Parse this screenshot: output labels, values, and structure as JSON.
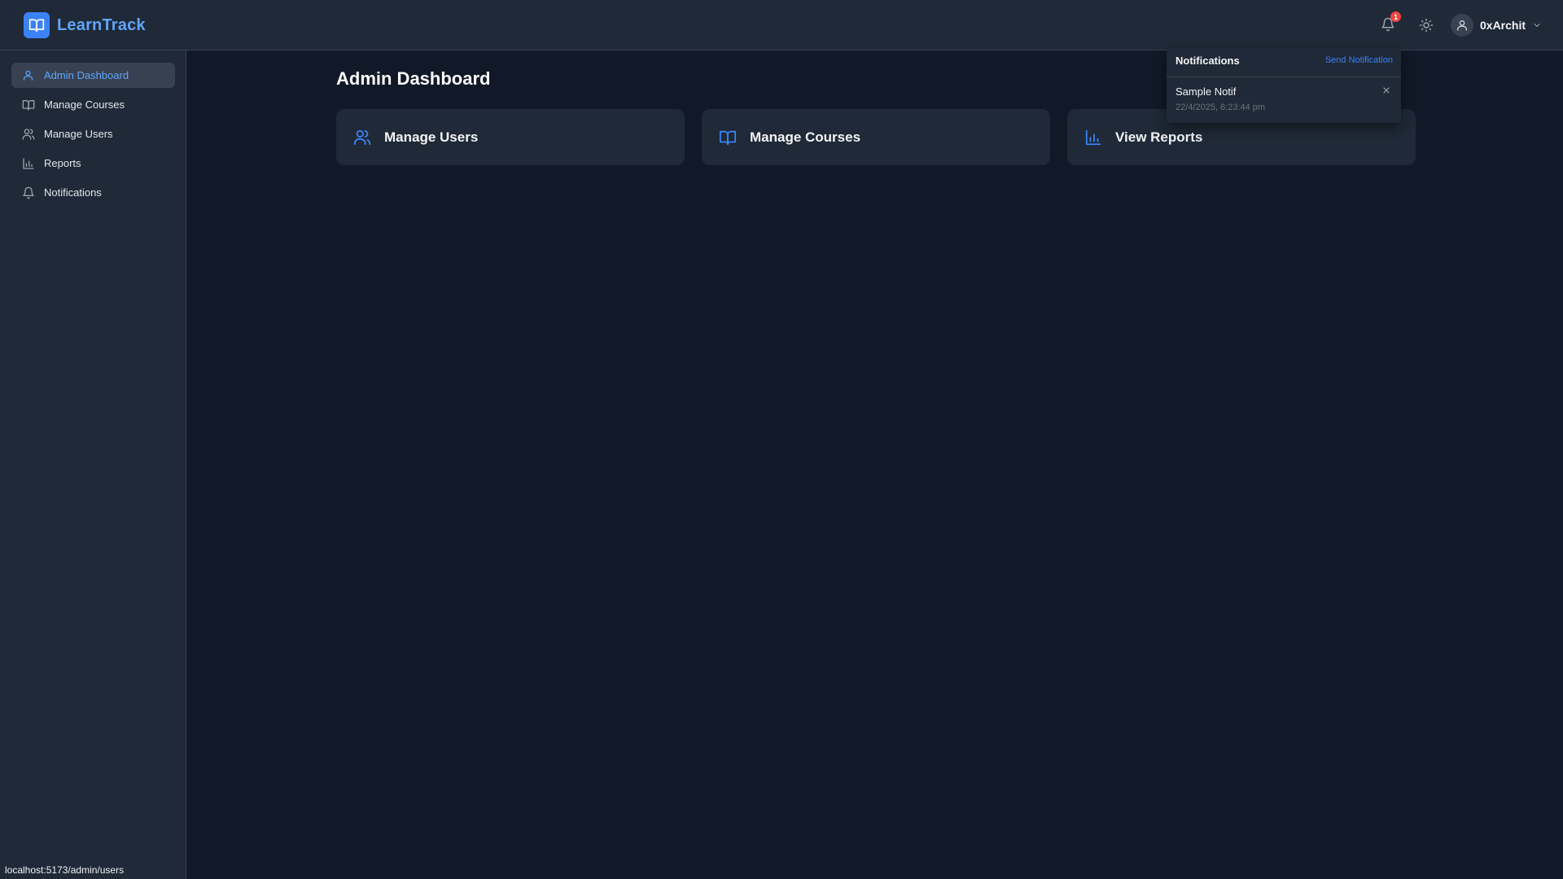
{
  "app": {
    "name": "LearnTrack"
  },
  "header": {
    "notification_count": "1",
    "username": "0xArchit"
  },
  "sidebar": {
    "items": [
      {
        "label": "Admin Dashboard",
        "icon": "user-icon",
        "active": true
      },
      {
        "label": "Manage Courses",
        "icon": "book-open-icon",
        "active": false
      },
      {
        "label": "Manage Users",
        "icon": "users-icon",
        "active": false
      },
      {
        "label": "Reports",
        "icon": "bar-chart-icon",
        "active": false
      },
      {
        "label": "Notifications",
        "icon": "bell-icon",
        "active": false
      }
    ]
  },
  "main": {
    "title": "Admin Dashboard",
    "cards": [
      {
        "label": "Manage Users",
        "icon": "users-icon"
      },
      {
        "label": "Manage Courses",
        "icon": "book-open-icon"
      },
      {
        "label": "View Reports",
        "icon": "bar-chart-icon"
      }
    ]
  },
  "notifications_panel": {
    "title": "Notifications",
    "send_label": "Send Notification",
    "items": [
      {
        "title": "Sample Notif",
        "time": "22/4/2025, 6:23:44 pm"
      }
    ]
  },
  "status_bar": {
    "url": "localhost:5173/admin/users"
  },
  "colors": {
    "accent": "#3b82f6",
    "accent_light": "#60a5fa",
    "background": "#111827",
    "surface": "#1f2937",
    "badge": "#ef4444"
  }
}
